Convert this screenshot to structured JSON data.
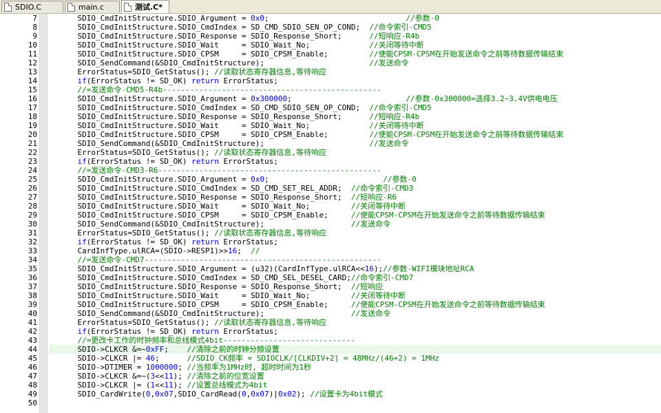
{
  "tabs": [
    {
      "label": "SDIO.C",
      "active": false
    },
    {
      "label": "main.c",
      "active": false
    },
    {
      "label": "测试.C*",
      "active": true
    }
  ],
  "highlight_line": 44,
  "lines": [
    {
      "n": "7",
      "segs": [
        [
          "p",
          "    SDIO_CmdInitStructure.SDIO_Argument = "
        ],
        [
          "num",
          "0x0"
        ],
        [
          "p",
          ";                              "
        ],
        [
          "cm",
          "//参数-0"
        ]
      ]
    },
    {
      "n": "8",
      "segs": [
        [
          "p",
          "    SDIO_CmdInitStructure.SDIO_CmdIndex = SD_CMD_SDIO_SEN_OP_COND;  "
        ],
        [
          "cm",
          "//命令索引-CMD5"
        ]
      ]
    },
    {
      "n": "9",
      "segs": [
        [
          "p",
          "    SDIO_CmdInitStructure.SDIO_Response = SDIO_Response_Short;      "
        ],
        [
          "cm",
          "//短响应-R4b"
        ]
      ]
    },
    {
      "n": "10",
      "segs": [
        [
          "p",
          "    SDIO_CmdInitStructure.SDIO_Wait     = SDIO_Wait_No;             "
        ],
        [
          "cm",
          "//关闭等待中断"
        ]
      ]
    },
    {
      "n": "11",
      "segs": [
        [
          "p",
          "    SDIO_CmdInitStructure.SDIO_CPSM     = SDIO_CPSM_Enable;         "
        ],
        [
          "cm",
          "//使能CPSM-CPSM在开始发送命令之前等待数据传输结束"
        ]
      ]
    },
    {
      "n": "12",
      "segs": [
        [
          "p",
          "    SDIO_SendCommand(&SDIO_CmdInitStructure);                       "
        ],
        [
          "cm",
          "//发送命令"
        ]
      ]
    },
    {
      "n": "13",
      "segs": [
        [
          "p",
          "    ErrorStatus=SDIO_GetStatus(); "
        ],
        [
          "cm",
          "//读取状态寄存器信息,等待响应"
        ]
      ]
    },
    {
      "n": "14",
      "segs": [
        [
          "p",
          "    "
        ],
        [
          "kw",
          "if"
        ],
        [
          "p",
          "(ErrorStatus != SD_OK) "
        ],
        [
          "kw",
          "return"
        ],
        [
          "p",
          " ErrorStatus;"
        ]
      ]
    },
    {
      "n": "15",
      "segs": [
        [
          "p",
          "    "
        ],
        [
          "cm",
          "//=发送命令-CMD5-R4b------------------------------------------------"
        ]
      ]
    },
    {
      "n": "16",
      "segs": [
        [
          "p",
          "    SDIO_CmdInitStructure.SDIO_Argument = "
        ],
        [
          "num",
          "0x300000"
        ],
        [
          "p",
          ";                         "
        ],
        [
          "cm",
          "//参数-0x300000=选择3.2~3.4V供电电压"
        ]
      ]
    },
    {
      "n": "17",
      "segs": [
        [
          "p",
          "    SDIO_CmdInitStructure.SDIO_CmdIndex = SD_CMD_SDIO_SEN_OP_COND;  "
        ],
        [
          "cm",
          "//命令索引-CMD5"
        ]
      ]
    },
    {
      "n": "18",
      "segs": [
        [
          "p",
          "    SDIO_CmdInitStructure.SDIO_Response = SDIO_Response_Short;      "
        ],
        [
          "cm",
          "//短响应-R4b"
        ]
      ]
    },
    {
      "n": "19",
      "segs": [
        [
          "p",
          "    SDIO_CmdInitStructure.SDIO_Wait     = SDIO_Wait_No;             "
        ],
        [
          "cm",
          "//关闭等待中断"
        ]
      ]
    },
    {
      "n": "20",
      "segs": [
        [
          "p",
          "    SDIO_CmdInitStructure.SDIO_CPSM     = SDIO_CPSM_Enable;         "
        ],
        [
          "cm",
          "//使能CPSM-CPSM在开始发送命令之前等待数据传输结束"
        ]
      ]
    },
    {
      "n": "21",
      "segs": [
        [
          "p",
          "    SDIO_SendCommand(&SDIO_CmdInitStructure);                       "
        ],
        [
          "cm",
          "//发送命令"
        ]
      ]
    },
    {
      "n": "22",
      "segs": [
        [
          "p",
          "    ErrorStatus=SDIO_GetStatus(); "
        ],
        [
          "cm",
          "//读取状态寄存器信息,等待响应"
        ]
      ]
    },
    {
      "n": "23",
      "segs": [
        [
          "p",
          "    "
        ],
        [
          "kw",
          "if"
        ],
        [
          "p",
          "(ErrorStatus != SD_OK) "
        ],
        [
          "kw",
          "return"
        ],
        [
          "p",
          " ErrorStatus;"
        ]
      ]
    },
    {
      "n": "24",
      "segs": [
        [
          "p",
          "    "
        ],
        [
          "cm",
          "//=发送命令-CMD3-R6-------------------------------------------------"
        ]
      ]
    },
    {
      "n": "25",
      "segs": [
        [
          "p",
          "    SDIO_CmdInitStructure.SDIO_Argument = "
        ],
        [
          "num",
          "0x0"
        ],
        [
          "p",
          ";                         "
        ],
        [
          "cm",
          "//参数-0"
        ]
      ]
    },
    {
      "n": "26",
      "segs": [
        [
          "p",
          "    SDIO_CmdInitStructure.SDIO_CmdIndex = SD_CMD_SET_REL_ADDR;  "
        ],
        [
          "cm",
          "//命令索引-CMD3"
        ]
      ]
    },
    {
      "n": "27",
      "segs": [
        [
          "p",
          "    SDIO_CmdInitStructure.SDIO_Response = SDIO_Response_Short;  "
        ],
        [
          "cm",
          "//短响应-R6"
        ]
      ]
    },
    {
      "n": "28",
      "segs": [
        [
          "p",
          "    SDIO_CmdInitStructure.SDIO_Wait     = SDIO_Wait_No;         "
        ],
        [
          "cm",
          "//关闭等待中断"
        ]
      ]
    },
    {
      "n": "29",
      "segs": [
        [
          "p",
          "    SDIO_CmdInitStructure.SDIO_CPSM     = SDIO_CPSM_Enable;     "
        ],
        [
          "cm",
          "//使能CPSM-CPSM在开始发送命令之前等待数据传输结束"
        ]
      ]
    },
    {
      "n": "30",
      "segs": [
        [
          "p",
          "    SDIO_SendCommand(&SDIO_CmdInitStructure);                   "
        ],
        [
          "cm",
          "//发送命令"
        ]
      ]
    },
    {
      "n": "31",
      "segs": [
        [
          "p",
          "    ErrorStatus=SDIO_GetStatus(); "
        ],
        [
          "cm",
          "//读取状态寄存器信息,等待响应"
        ]
      ]
    },
    {
      "n": "32",
      "segs": [
        [
          "p",
          "    "
        ],
        [
          "kw",
          "if"
        ],
        [
          "p",
          "(ErrorStatus != SD_OK) "
        ],
        [
          "kw",
          "return"
        ],
        [
          "p",
          " ErrorStatus;"
        ]
      ]
    },
    {
      "n": "33",
      "segs": [
        [
          "p",
          "    CardInfType.ulRCA=(SDIO->RESP1)>>"
        ],
        [
          "num",
          "16"
        ],
        [
          "p",
          ";  "
        ],
        [
          "cm",
          "//"
        ]
      ]
    },
    {
      "n": "34",
      "segs": [
        [
          "p",
          "    "
        ],
        [
          "cm",
          "//=发送命令-CMD7----------------------------------------------------"
        ]
      ]
    },
    {
      "n": "35",
      "segs": [
        [
          "p",
          "    SDIO_CmdInitStructure.SDIO_Argument = (u32)(CardInfType.ulRCA<<"
        ],
        [
          "num",
          "16"
        ],
        [
          "p",
          ");"
        ],
        [
          "cm",
          "//参数-WIFI模块地址RCA"
        ]
      ]
    },
    {
      "n": "36",
      "segs": [
        [
          "p",
          "    SDIO_CmdInitStructure.SDIO_CmdIndex = SD_CMD_SEL_DESEL_CARD;"
        ],
        [
          "cm",
          "//命令索引-CMD7"
        ]
      ]
    },
    {
      "n": "37",
      "segs": [
        [
          "p",
          "    SDIO_CmdInitStructure.SDIO_Response = SDIO_Response_Short;  "
        ],
        [
          "cm",
          "//短响应"
        ]
      ]
    },
    {
      "n": "38",
      "segs": [
        [
          "p",
          "    SDIO_CmdInitStructure.SDIO_Wait     = SDIO_Wait_No;         "
        ],
        [
          "cm",
          "//关闭等待中断"
        ]
      ]
    },
    {
      "n": "39",
      "segs": [
        [
          "p",
          "    SDIO_CmdInitStructure.SDIO_CPSM     = SDIO_CPSM_Enable;     "
        ],
        [
          "cm",
          "//使能CPSM-CPSM在开始发送命令之前等待数据传输结束"
        ]
      ]
    },
    {
      "n": "40",
      "segs": [
        [
          "p",
          "    SDIO_SendCommand(&SDIO_CmdInitStructure);                   "
        ],
        [
          "cm",
          "//发送命令"
        ]
      ]
    },
    {
      "n": "41",
      "segs": [
        [
          "p",
          "    ErrorStatus=SDIO_GetStatus(); "
        ],
        [
          "cm",
          "//读取状态寄存器信息,等待响应"
        ]
      ]
    },
    {
      "n": "42",
      "segs": [
        [
          "p",
          "    "
        ],
        [
          "kw",
          "if"
        ],
        [
          "p",
          "(ErrorStatus != SD_OK) "
        ],
        [
          "kw",
          "return"
        ],
        [
          "p",
          " ErrorStatus;"
        ]
      ]
    },
    {
      "n": "43",
      "segs": [
        [
          "p",
          "    "
        ],
        [
          "cm",
          "//=更改卡工作的时钟频率和总线模式4bit-----------------------------"
        ]
      ]
    },
    {
      "n": "44",
      "segs": [
        [
          "p",
          "    SDIO->CLKCR &=~"
        ],
        [
          "num",
          "0xFF"
        ],
        [
          "p",
          ";    "
        ],
        [
          "cm",
          "//清除之前的时钟分频设置"
        ]
      ]
    },
    {
      "n": "45",
      "segs": [
        [
          "p",
          "    SDIO->CLKCR |= "
        ],
        [
          "num",
          "46"
        ],
        [
          "p",
          ";      "
        ],
        [
          "cm",
          "//SDIO_CK频率 = SDIOCLK/[CLKDIV+2] = 48MHz/(46+2) = 1MHz"
        ]
      ]
    },
    {
      "n": "46",
      "segs": [
        [
          "p",
          "    SDIO->DTIMER = "
        ],
        [
          "num",
          "1000000"
        ],
        [
          "p",
          "; "
        ],
        [
          "cm",
          "//当频率为1MHz时, 超时时间为1秒"
        ]
      ]
    },
    {
      "n": "47",
      "segs": [
        [
          "p",
          "    SDIO->CLKCR &=~("
        ],
        [
          "num",
          "3"
        ],
        [
          "p",
          "<<"
        ],
        [
          "num",
          "11"
        ],
        [
          "p",
          "); "
        ],
        [
          "cm",
          "//清除之前的位宽设置"
        ]
      ]
    },
    {
      "n": "48",
      "segs": [
        [
          "p",
          "    SDIO->CLKCR |= ("
        ],
        [
          "num",
          "1"
        ],
        [
          "p",
          "<<"
        ],
        [
          "num",
          "11"
        ],
        [
          "p",
          "); "
        ],
        [
          "cm",
          "//设置总线模式为4bit"
        ]
      ]
    },
    {
      "n": "49",
      "segs": [
        [
          "p",
          "    SDIO_CardWrite("
        ],
        [
          "num",
          "0"
        ],
        [
          "p",
          ","
        ],
        [
          "num",
          "0x07"
        ],
        [
          "p",
          ",SDIO_CardRead("
        ],
        [
          "num",
          "0"
        ],
        [
          "p",
          ","
        ],
        [
          "num",
          "0x07"
        ],
        [
          "p",
          ")|"
        ],
        [
          "num",
          "0x02"
        ],
        [
          "p",
          "); "
        ],
        [
          "cm",
          "//设置卡为4bit模式"
        ]
      ]
    },
    {
      "n": "50",
      "segs": []
    }
  ]
}
